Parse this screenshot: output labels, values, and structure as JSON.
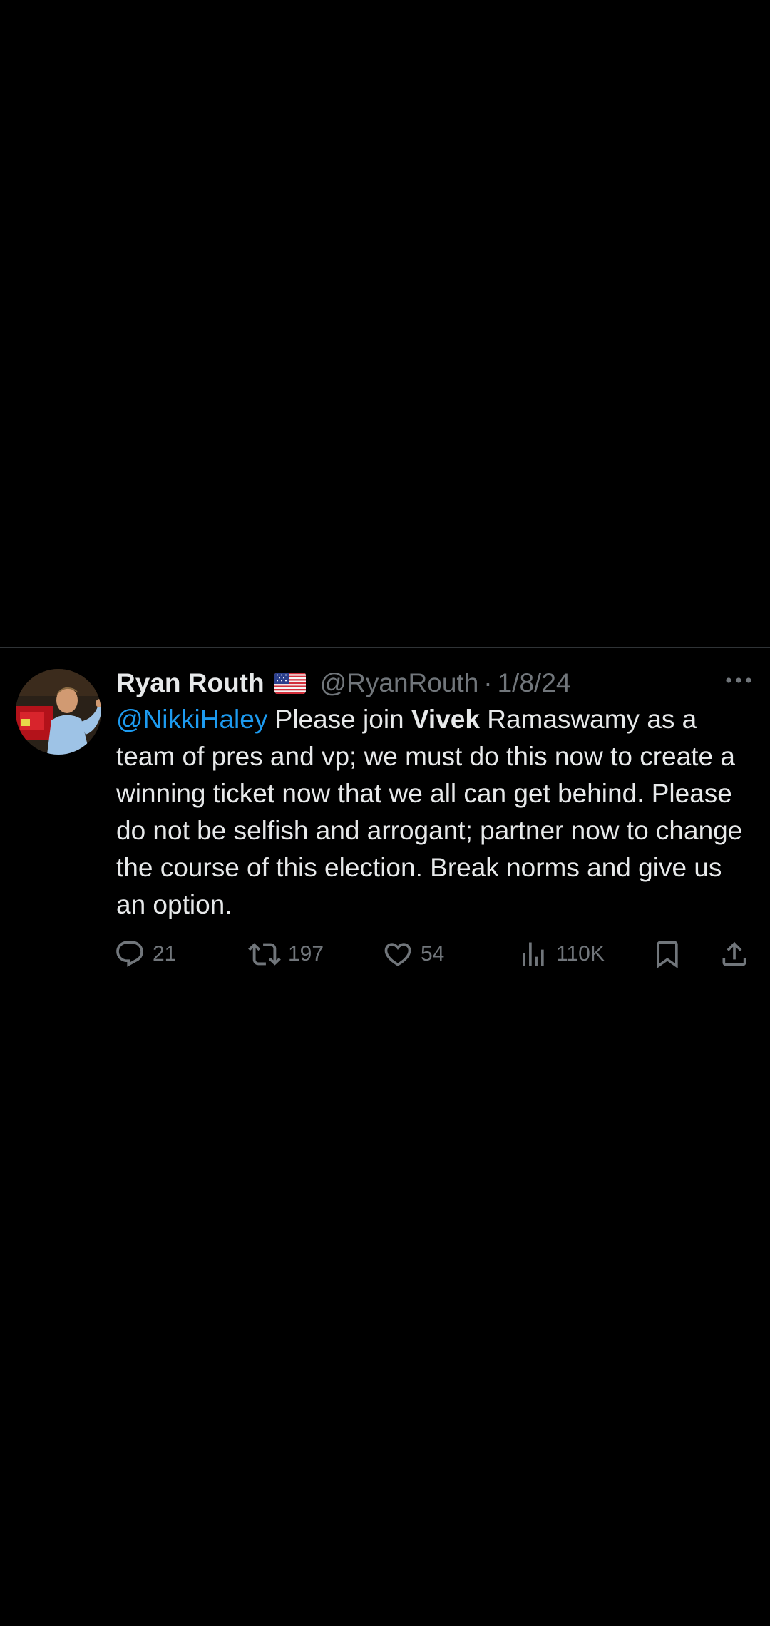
{
  "tweet": {
    "author_name": "Ryan Routh",
    "flag_emoji": "🇺🇸",
    "handle": "@RyanRouth",
    "separator": "·",
    "date": "1/8/24",
    "mention": "@NikkiHaley",
    "text_part1": " Please join ",
    "bold_word": "Vivek",
    "text_part2": " Ramaswamy as a team  of pres and vp; we must do this now to create a winning ticket now that we all can get behind. Please do not be selfish and arrogant; partner now to change the course of this election. Break norms and give us an option."
  },
  "actions": {
    "reply_count": "21",
    "retweet_count": "197",
    "like_count": "54",
    "views_count": "110K"
  },
  "icons": {
    "avatar": "profile-photo",
    "flag": "us-flag-icon",
    "more": "more-dots-icon",
    "reply": "reply-icon",
    "retweet": "retweet-icon",
    "like": "heart-icon",
    "views": "views-icon",
    "bookmark": "bookmark-icon",
    "share": "share-icon"
  },
  "colors": {
    "background": "#000000",
    "text": "#e7e9ea",
    "secondary": "#71767b",
    "link": "#1d9bf0",
    "divider": "#2f3336"
  }
}
